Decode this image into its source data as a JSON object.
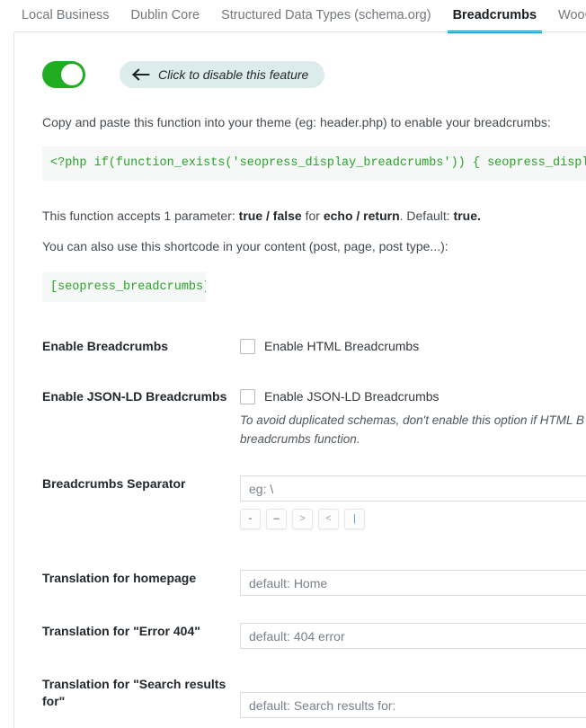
{
  "tabs": [
    {
      "label": "Local Business",
      "active": false
    },
    {
      "label": "Dublin Core",
      "active": false
    },
    {
      "label": "Structured Data Types (schema.org)",
      "active": false
    },
    {
      "label": "Breadcrumbs",
      "active": true
    },
    {
      "label": "WooCommerce",
      "active": false
    }
  ],
  "feature_toggle": {
    "state": "enabled",
    "hint_label": "Click to disable this feature",
    "hint_icon": "arrow-left-icon",
    "color": "#21ad21",
    "hint_background": "#dcecea"
  },
  "intro": {
    "copy_paste_text": "Copy and paste this function into your theme (eg: header.php) to enable your breadcrumbs:",
    "php_code": "<?php if(function_exists('seopress_display_breadcrumbs')) { seopress_display_",
    "parameter_text_1": "This function accepts 1 parameter: ",
    "parameter_bold_1": "true / false",
    "parameter_text_2": " for ",
    "parameter_bold_2": "echo / return",
    "parameter_text_3": ". Default: ",
    "parameter_bold_3": "true.",
    "shortcode_text": "You can also use this shortcode in your content (post, page, post type...):",
    "shortcode": "[seopress_breadcrumbs]"
  },
  "settings": {
    "enable_breadcrumbs": {
      "label": "Enable Breadcrumbs",
      "checkbox_label": "Enable HTML Breadcrumbs",
      "checked": false
    },
    "enable_jsonld": {
      "label": "Enable JSON-LD Breadcrumbs",
      "checkbox_label": "Enable JSON-LD Breadcrumbs",
      "checked": false,
      "helper": "To avoid duplicated schemas, don't enable this option if HTML B\nbreadcrumbs function."
    },
    "separator": {
      "label": "Breadcrumbs Separator",
      "placeholder": "eg: \\",
      "value": "",
      "buttons": [
        "-",
        "–",
        ">",
        "<",
        "|"
      ]
    },
    "translation_homepage": {
      "label": "Translation for homepage",
      "placeholder": "default: Home",
      "value": ""
    },
    "translation_404": {
      "label": "Translation for \"Error 404\"",
      "placeholder": "default: 404 error",
      "value": ""
    },
    "translation_search": {
      "label": "Translation for \"Search results\nfor\"",
      "placeholder": "default: Search results for:",
      "value": ""
    }
  }
}
